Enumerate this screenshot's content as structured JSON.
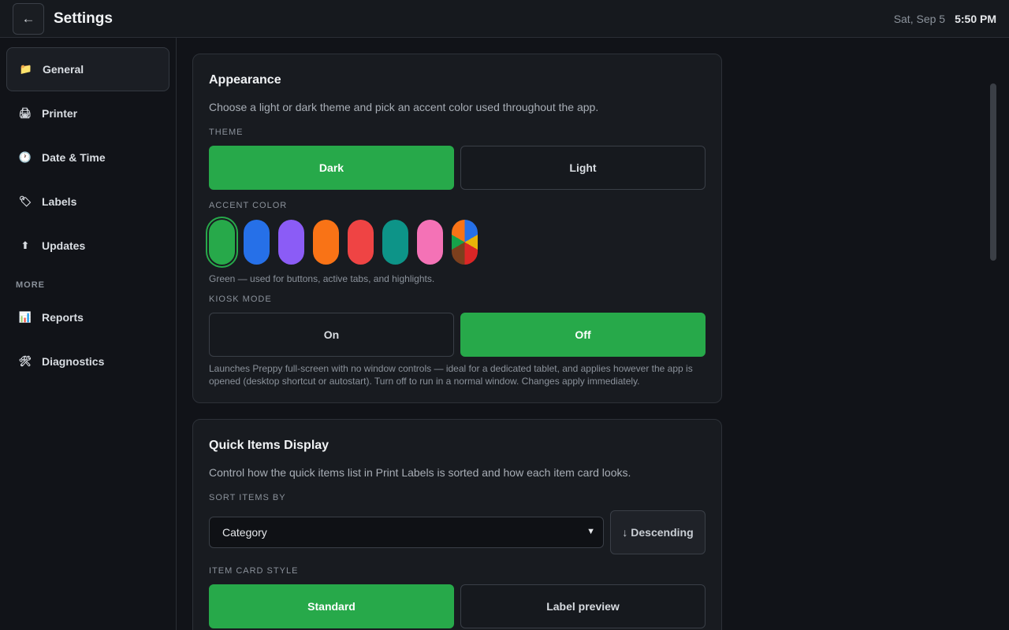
{
  "header": {
    "back_icon": "←",
    "title": "Settings",
    "date": "Sat, Sep 5",
    "time": "5:50 PM"
  },
  "sidebar": {
    "items": [
      {
        "label": "General",
        "icon": "folder-icon",
        "glyph": "📁",
        "active": true
      },
      {
        "label": "Printer",
        "icon": "printer-icon",
        "glyph": "🖨"
      },
      {
        "label": "Date & Time",
        "icon": "clock-icon",
        "glyph": "🕐"
      },
      {
        "label": "Labels",
        "icon": "tag-icon",
        "glyph": "🏷"
      },
      {
        "label": "Updates",
        "icon": "up-arrow-icon",
        "glyph": "⬆"
      }
    ],
    "more_label": "MORE",
    "more_items": [
      {
        "label": "Reports",
        "icon": "bar-chart-icon",
        "glyph": "📊"
      },
      {
        "label": "Diagnostics",
        "icon": "tools-icon",
        "glyph": "🛠"
      }
    ]
  },
  "appearance": {
    "title": "Appearance",
    "description": "Choose a light or dark theme and pick an accent color used throughout the app.",
    "theme_label": "THEME",
    "theme_options": [
      "Dark",
      "Light"
    ],
    "theme_selected": "Dark",
    "accent_label": "ACCENT COLOR",
    "accent_colors": [
      "#27a94a",
      "#2670e8",
      "#8b5cf6",
      "#f97316",
      "#ef4444",
      "#0d9488",
      "#f472b6"
    ],
    "accent_selected": "#27a94a",
    "accent_help": "Green — used for buttons, active tabs, and highlights.",
    "kiosk_label": "KIOSK MODE",
    "kiosk_options": [
      "On",
      "Off"
    ],
    "kiosk_selected": "Off",
    "kiosk_help": "Launches Preppy full-screen with no window controls — ideal for a dedicated tablet, and applies however the app is opened (desktop shortcut or autostart). Turn off to run in a normal window. Changes apply immediately."
  },
  "quick_items": {
    "title": "Quick Items Display",
    "description": "Control how the quick items list in Print Labels is sorted and how each item card looks.",
    "sort_label": "SORT ITEMS BY",
    "sort_value": "Category",
    "order_label": "↓ Descending",
    "card_style_label": "ITEM CARD STYLE",
    "card_style_options": [
      "Standard",
      "Label preview"
    ],
    "card_style_selected": "Standard"
  },
  "colors": {
    "accent": "#27a94a",
    "background": "#111318",
    "card": "#181b20"
  }
}
